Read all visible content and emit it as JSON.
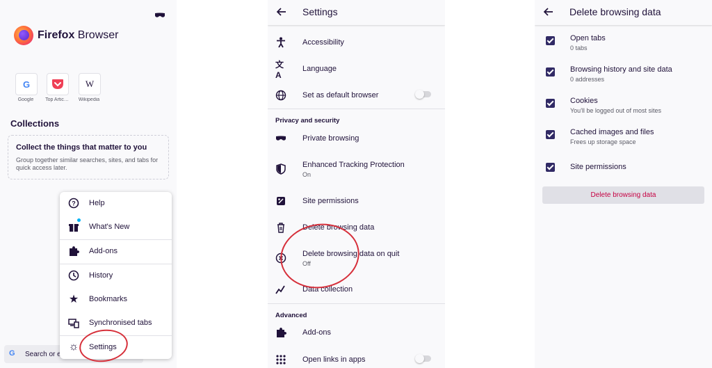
{
  "home": {
    "brand_bold": "Firefox",
    "brand_rest": " Browser",
    "sites": [
      {
        "letter": "G",
        "label": "Google",
        "color": "#4285f4"
      },
      {
        "letter": "✓",
        "label": "Top Artic…",
        "color": "#ef4056"
      },
      {
        "letter": "W",
        "label": "Wikipedia",
        "color": "#20123a"
      }
    ],
    "collections_title": "Collections",
    "collections_heading": "Collect the things that matter to you",
    "collections_desc": "Group together similar searches, sites, and tabs for quick access later.",
    "search_text": "Search or e",
    "menu": [
      {
        "icon": "help-icon",
        "label": "Help"
      },
      {
        "icon": "gift-icon",
        "label": "What's New"
      },
      {
        "icon": "puzzle-icon",
        "label": "Add-ons"
      },
      {
        "icon": "clock-icon",
        "label": "History"
      },
      {
        "icon": "star-icon",
        "label": "Bookmarks"
      },
      {
        "icon": "devices-icon",
        "label": "Synchronised tabs"
      },
      {
        "icon": "gear-icon",
        "label": "Settings"
      }
    ]
  },
  "settings": {
    "title": "Settings",
    "items_general": [
      {
        "icon": "accessibility-icon",
        "label": "Accessibility"
      },
      {
        "icon": "translate-icon",
        "label": "Language"
      },
      {
        "icon": "globe-icon",
        "label": "Set as default browser"
      }
    ],
    "privacy_header": "Privacy and security",
    "items_privacy": [
      {
        "icon": "mask-icon",
        "label": "Private browsing"
      },
      {
        "icon": "shield-icon",
        "label": "Enhanced Tracking Protection",
        "sub": "On"
      },
      {
        "icon": "permissions-icon",
        "label": "Site permissions"
      },
      {
        "icon": "trash-icon",
        "label": "Delete browsing data"
      },
      {
        "icon": "close-circle-icon",
        "label": "Delete browsing data on quit",
        "sub": "Off"
      },
      {
        "icon": "chart-line-icon",
        "label": "Data collection"
      }
    ],
    "advanced_header": "Advanced",
    "items_advanced": [
      {
        "icon": "puzzle-icon",
        "label": "Add-ons"
      },
      {
        "icon": "grid-icon",
        "label": "Open links in apps"
      }
    ]
  },
  "delete_data": {
    "title": "Delete browsing data",
    "items": [
      {
        "label": "Open tabs",
        "sub": "0 tabs"
      },
      {
        "label": "Browsing history and site data",
        "sub": "0 addresses"
      },
      {
        "label": "Cookies",
        "sub": "You'll be logged out of most sites"
      },
      {
        "label": "Cached images and files",
        "sub": "Frees up storage space"
      },
      {
        "label": "Site permissions",
        "sub": ""
      }
    ],
    "button": "Delete browsing data"
  }
}
